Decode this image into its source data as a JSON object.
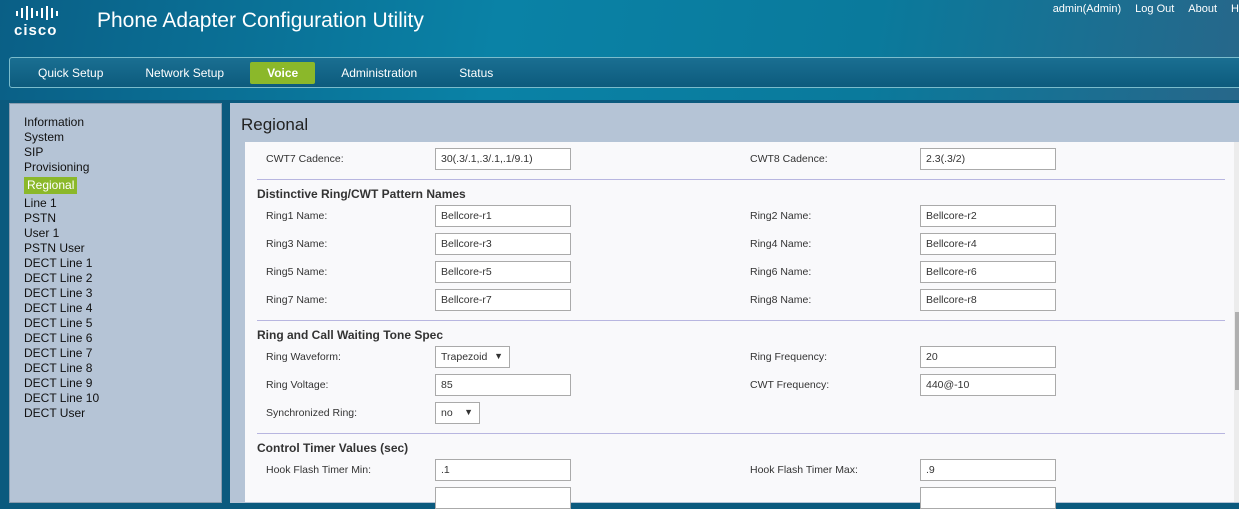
{
  "header": {
    "logo": "cisco",
    "title": "Phone Adapter Configuration Utility",
    "links": [
      "admin(Admin)",
      "Log Out",
      "About",
      "H"
    ]
  },
  "nav": {
    "tabs": [
      "Quick Setup",
      "Network Setup",
      "Voice",
      "Administration",
      "Status"
    ],
    "active": "Voice"
  },
  "sidebar": {
    "items": [
      "Information",
      "System",
      "SIP",
      "Provisioning",
      "Regional",
      "Line 1",
      "PSTN",
      "User 1",
      "PSTN User",
      "DECT Line 1",
      "DECT Line 2",
      "DECT Line 3",
      "DECT Line 4",
      "DECT Line 5",
      "DECT Line 6",
      "DECT Line 7",
      "DECT Line 8",
      "DECT Line 9",
      "DECT Line 10",
      "DECT User"
    ],
    "active": "Regional"
  },
  "page": {
    "title": "Regional",
    "cwt": {
      "l_label": "CWT7 Cadence:",
      "l_value": "30(.3/.1,.3/.1,.1/9.1)",
      "r_label": "CWT8 Cadence:",
      "r_value": "2.3(.3/2)"
    },
    "sections": [
      {
        "title": "Distinctive Ring/CWT Pattern Names",
        "rows": [
          {
            "l_label": "Ring1 Name:",
            "l_value": "Bellcore-r1",
            "r_label": "Ring2 Name:",
            "r_value": "Bellcore-r2"
          },
          {
            "l_label": "Ring3 Name:",
            "l_value": "Bellcore-r3",
            "r_label": "Ring4 Name:",
            "r_value": "Bellcore-r4"
          },
          {
            "l_label": "Ring5 Name:",
            "l_value": "Bellcore-r5",
            "r_label": "Ring6 Name:",
            "r_value": "Bellcore-r6"
          },
          {
            "l_label": "Ring7 Name:",
            "l_value": "Bellcore-r7",
            "r_label": "Ring8 Name:",
            "r_value": "Bellcore-r8"
          }
        ]
      },
      {
        "title": "Ring and Call Waiting Tone Spec",
        "rows": [
          {
            "l_label": "Ring Waveform:",
            "l_value": "Trapezoid",
            "r_label": "Ring Frequency:",
            "r_value": "20"
          },
          {
            "l_label": "Ring Voltage:",
            "l_value": "85",
            "r_label": "CWT Frequency:",
            "r_value": "440@-10"
          },
          {
            "l_label": "Synchronized Ring:",
            "l_value": "no"
          }
        ]
      },
      {
        "title": "Control Timer Values (sec)",
        "rows": [
          {
            "l_label": "Hook Flash Timer Min:",
            "l_value": ".1",
            "r_label": "Hook Flash Timer Max:",
            "r_value": ".9"
          }
        ]
      }
    ]
  }
}
